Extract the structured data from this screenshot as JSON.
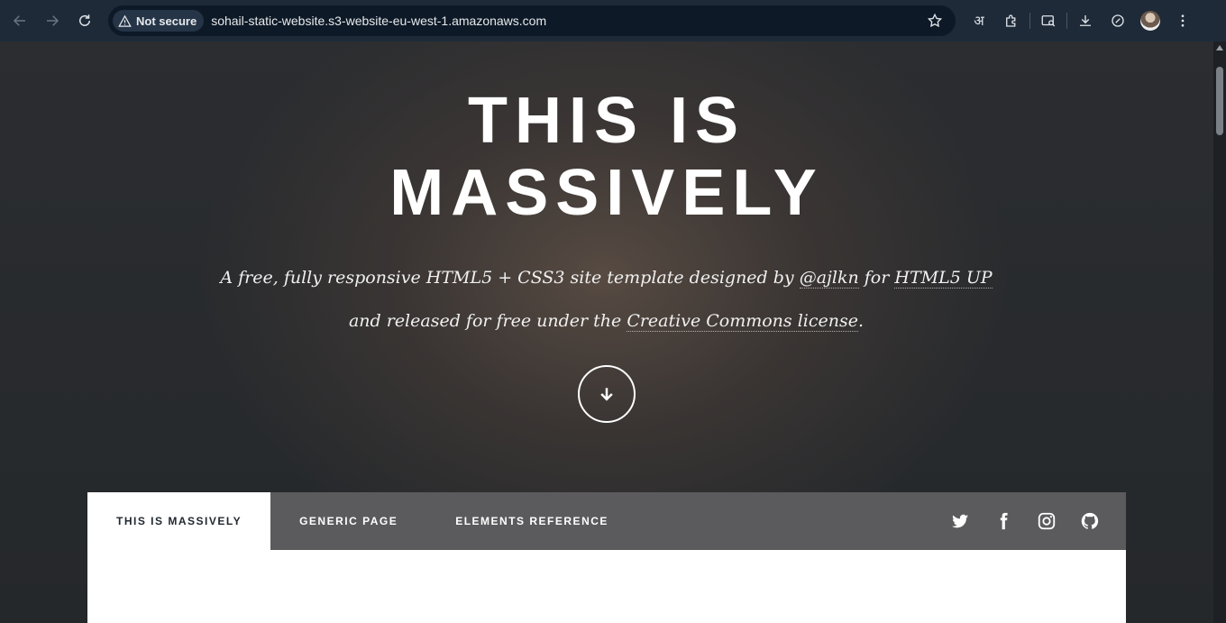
{
  "browser": {
    "security_label": "Not secure",
    "url": "sohail-static-website.s3-website-eu-west-1.amazonaws.com",
    "translate_glyph": "अ"
  },
  "hero": {
    "title_line1": "THIS IS",
    "title_line2": "MASSIVELY",
    "subtitle_part1": "A free, fully responsive HTML5 + CSS3 site template designed by ",
    "subtitle_link1": "@ajlkn",
    "subtitle_part2": " for ",
    "subtitle_link2": "HTML5 UP",
    "subtitle_part3": " and released for free under the ",
    "subtitle_link3": "Creative Commons license",
    "subtitle_part4": "."
  },
  "nav": {
    "tabs": [
      {
        "label": "THIS IS MASSIVELY"
      },
      {
        "label": "GENERIC PAGE"
      },
      {
        "label": "ELEMENTS REFERENCE"
      }
    ],
    "socials": [
      "twitter-icon",
      "facebook-icon",
      "instagram-icon",
      "github-icon"
    ]
  },
  "colors": {
    "chrome": "#1e2a38",
    "omnibox": "#0d1926",
    "nav_active_bg": "#ffffff",
    "nav_text_active": "#212931"
  }
}
